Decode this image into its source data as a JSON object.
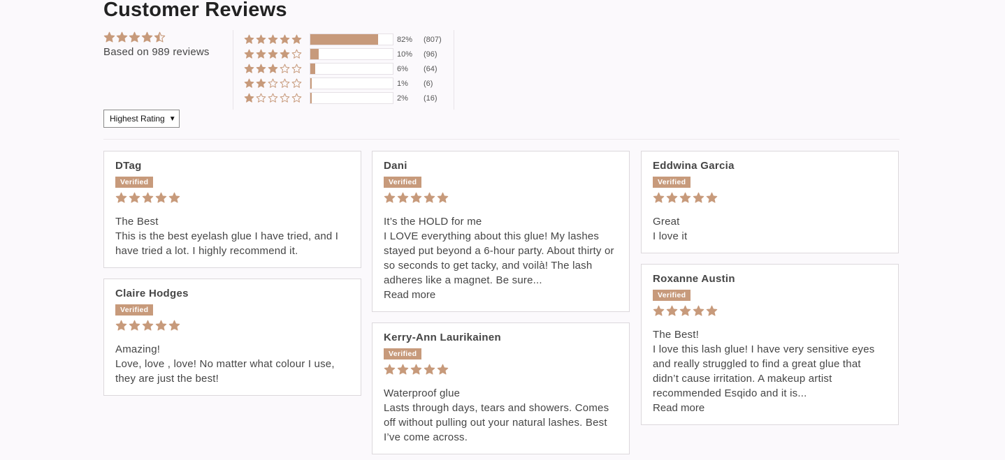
{
  "header": {
    "title": "Customer Reviews"
  },
  "summary": {
    "average_rating": 4.5,
    "based_on": "Based on 989 reviews"
  },
  "histogram": [
    {
      "stars": 5,
      "percent_label": "82%",
      "count_label": "(807)",
      "fraction": 0.82
    },
    {
      "stars": 4,
      "percent_label": "10%",
      "count_label": "(96)",
      "fraction": 0.1
    },
    {
      "stars": 3,
      "percent_label": "6%",
      "count_label": "(64)",
      "fraction": 0.06
    },
    {
      "stars": 2,
      "percent_label": "1%",
      "count_label": "(6)",
      "fraction": 0.01
    },
    {
      "stars": 1,
      "percent_label": "2%",
      "count_label": "(16)",
      "fraction": 0.02
    }
  ],
  "sort": {
    "selected": "Highest Rating"
  },
  "colors": {
    "accent": "#c79a7b",
    "text": "#454545",
    "background": "#fbf9fc"
  },
  "reviews": [
    {
      "name": "DTag",
      "badge": "Verified",
      "rating": 5,
      "title": "The Best",
      "body": "This is the best eyelash glue I have tried, and I have tried a lot. I highly recommend it."
    },
    {
      "name": "Claire Hodges",
      "badge": "Verified",
      "rating": 5,
      "title": "Amazing!",
      "body": "Love, love , love! No matter what colour I use, they are just the best!"
    },
    {
      "name": "Dani",
      "badge": "Verified",
      "rating": 5,
      "title": "It’s the HOLD for me",
      "body": "I LOVE everything about this glue! My lashes stayed put beyond a 6-hour party. About thirty or so seconds to get tacky, and voilà! The lash adheres like a magnet. Be sure...",
      "read_more": "Read more"
    },
    {
      "name": "Kerry-Ann Laurikainen",
      "badge": "Verified",
      "rating": 5,
      "title": "Waterproof glue",
      "body": "Lasts through days, tears and showers. Comes off without pulling out your natural lashes. Best I’ve come across."
    },
    {
      "name": "Eddwina Garcia",
      "badge": "Verified",
      "rating": 5,
      "title": "Great",
      "body": "I love it"
    },
    {
      "name": "Roxanne Austin",
      "badge": "Verified",
      "rating": 5,
      "title": "The Best!",
      "body": "I love this lash glue! I have very sensitive eyes and really struggled to find a great glue that didn’t cause irritation. A makeup artist recommended Esqido and it is...",
      "read_more": "Read more"
    }
  ]
}
